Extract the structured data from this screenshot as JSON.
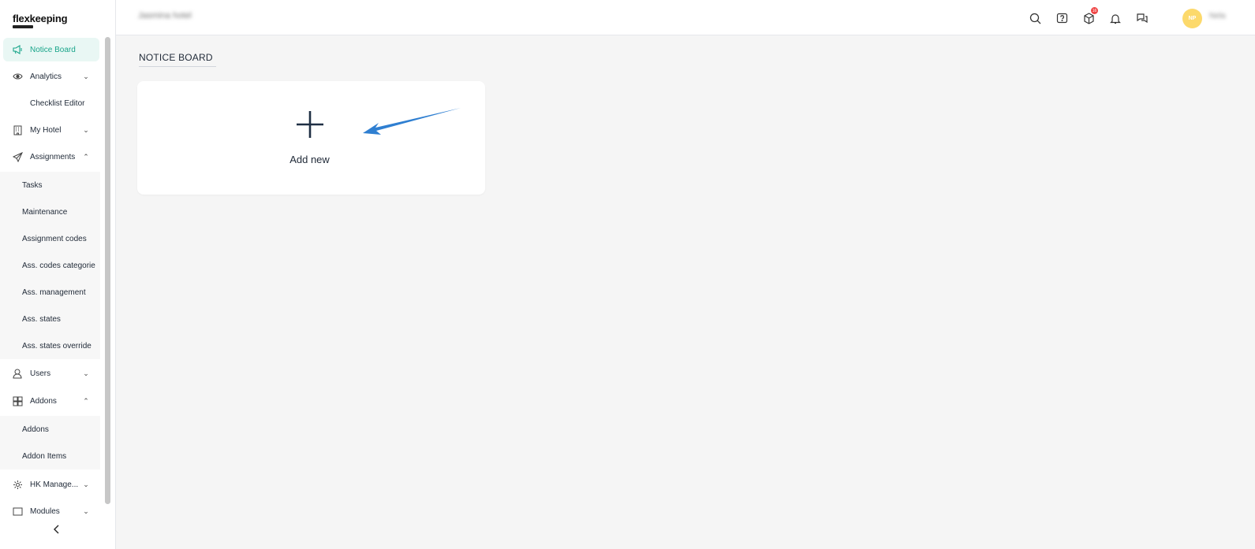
{
  "app": {
    "logo_text": "flexkeeping"
  },
  "header": {
    "hotel_name": "Jasmina hotel",
    "badge_count": "16",
    "avatar_initials": "NP",
    "user_name": "Nela",
    "icons": [
      "search-icon",
      "help-icon",
      "box-icon",
      "bell-icon",
      "chat-icon"
    ]
  },
  "sidebar": {
    "items": [
      {
        "label": "Notice Board",
        "icon": "megaphone-icon",
        "active": true
      },
      {
        "label": "Analytics",
        "icon": "eye-icon",
        "chevron": "down"
      },
      {
        "label": "Checklist Editor"
      },
      {
        "label": "My Hotel",
        "icon": "building-icon",
        "chevron": "down"
      },
      {
        "label": "Assignments",
        "icon": "send-icon",
        "chevron": "up"
      },
      {
        "label": "Users",
        "icon": "user-icon",
        "chevron": "down"
      },
      {
        "label": "Addons",
        "icon": "grid-icon",
        "chevron": "up"
      },
      {
        "label": "HK Manage...",
        "icon": "gear-icon",
        "chevron": "down"
      },
      {
        "label": "Modules",
        "icon": "module-icon",
        "chevron": "down"
      }
    ],
    "assignments_sub": [
      "Tasks",
      "Maintenance",
      "Assignment codes",
      "Ass. codes categorie",
      "Ass. management",
      "Ass. states",
      "Ass. states override"
    ],
    "addons_sub": [
      "Addons",
      "Addon Items"
    ]
  },
  "main": {
    "title": "NOTICE BOARD",
    "card": {
      "label": "Add new"
    }
  },
  "colors": {
    "accent": "#19a58a",
    "arrow": "#2f7fd1",
    "avatar": "#fcd96b",
    "badge": "#ef4444"
  }
}
